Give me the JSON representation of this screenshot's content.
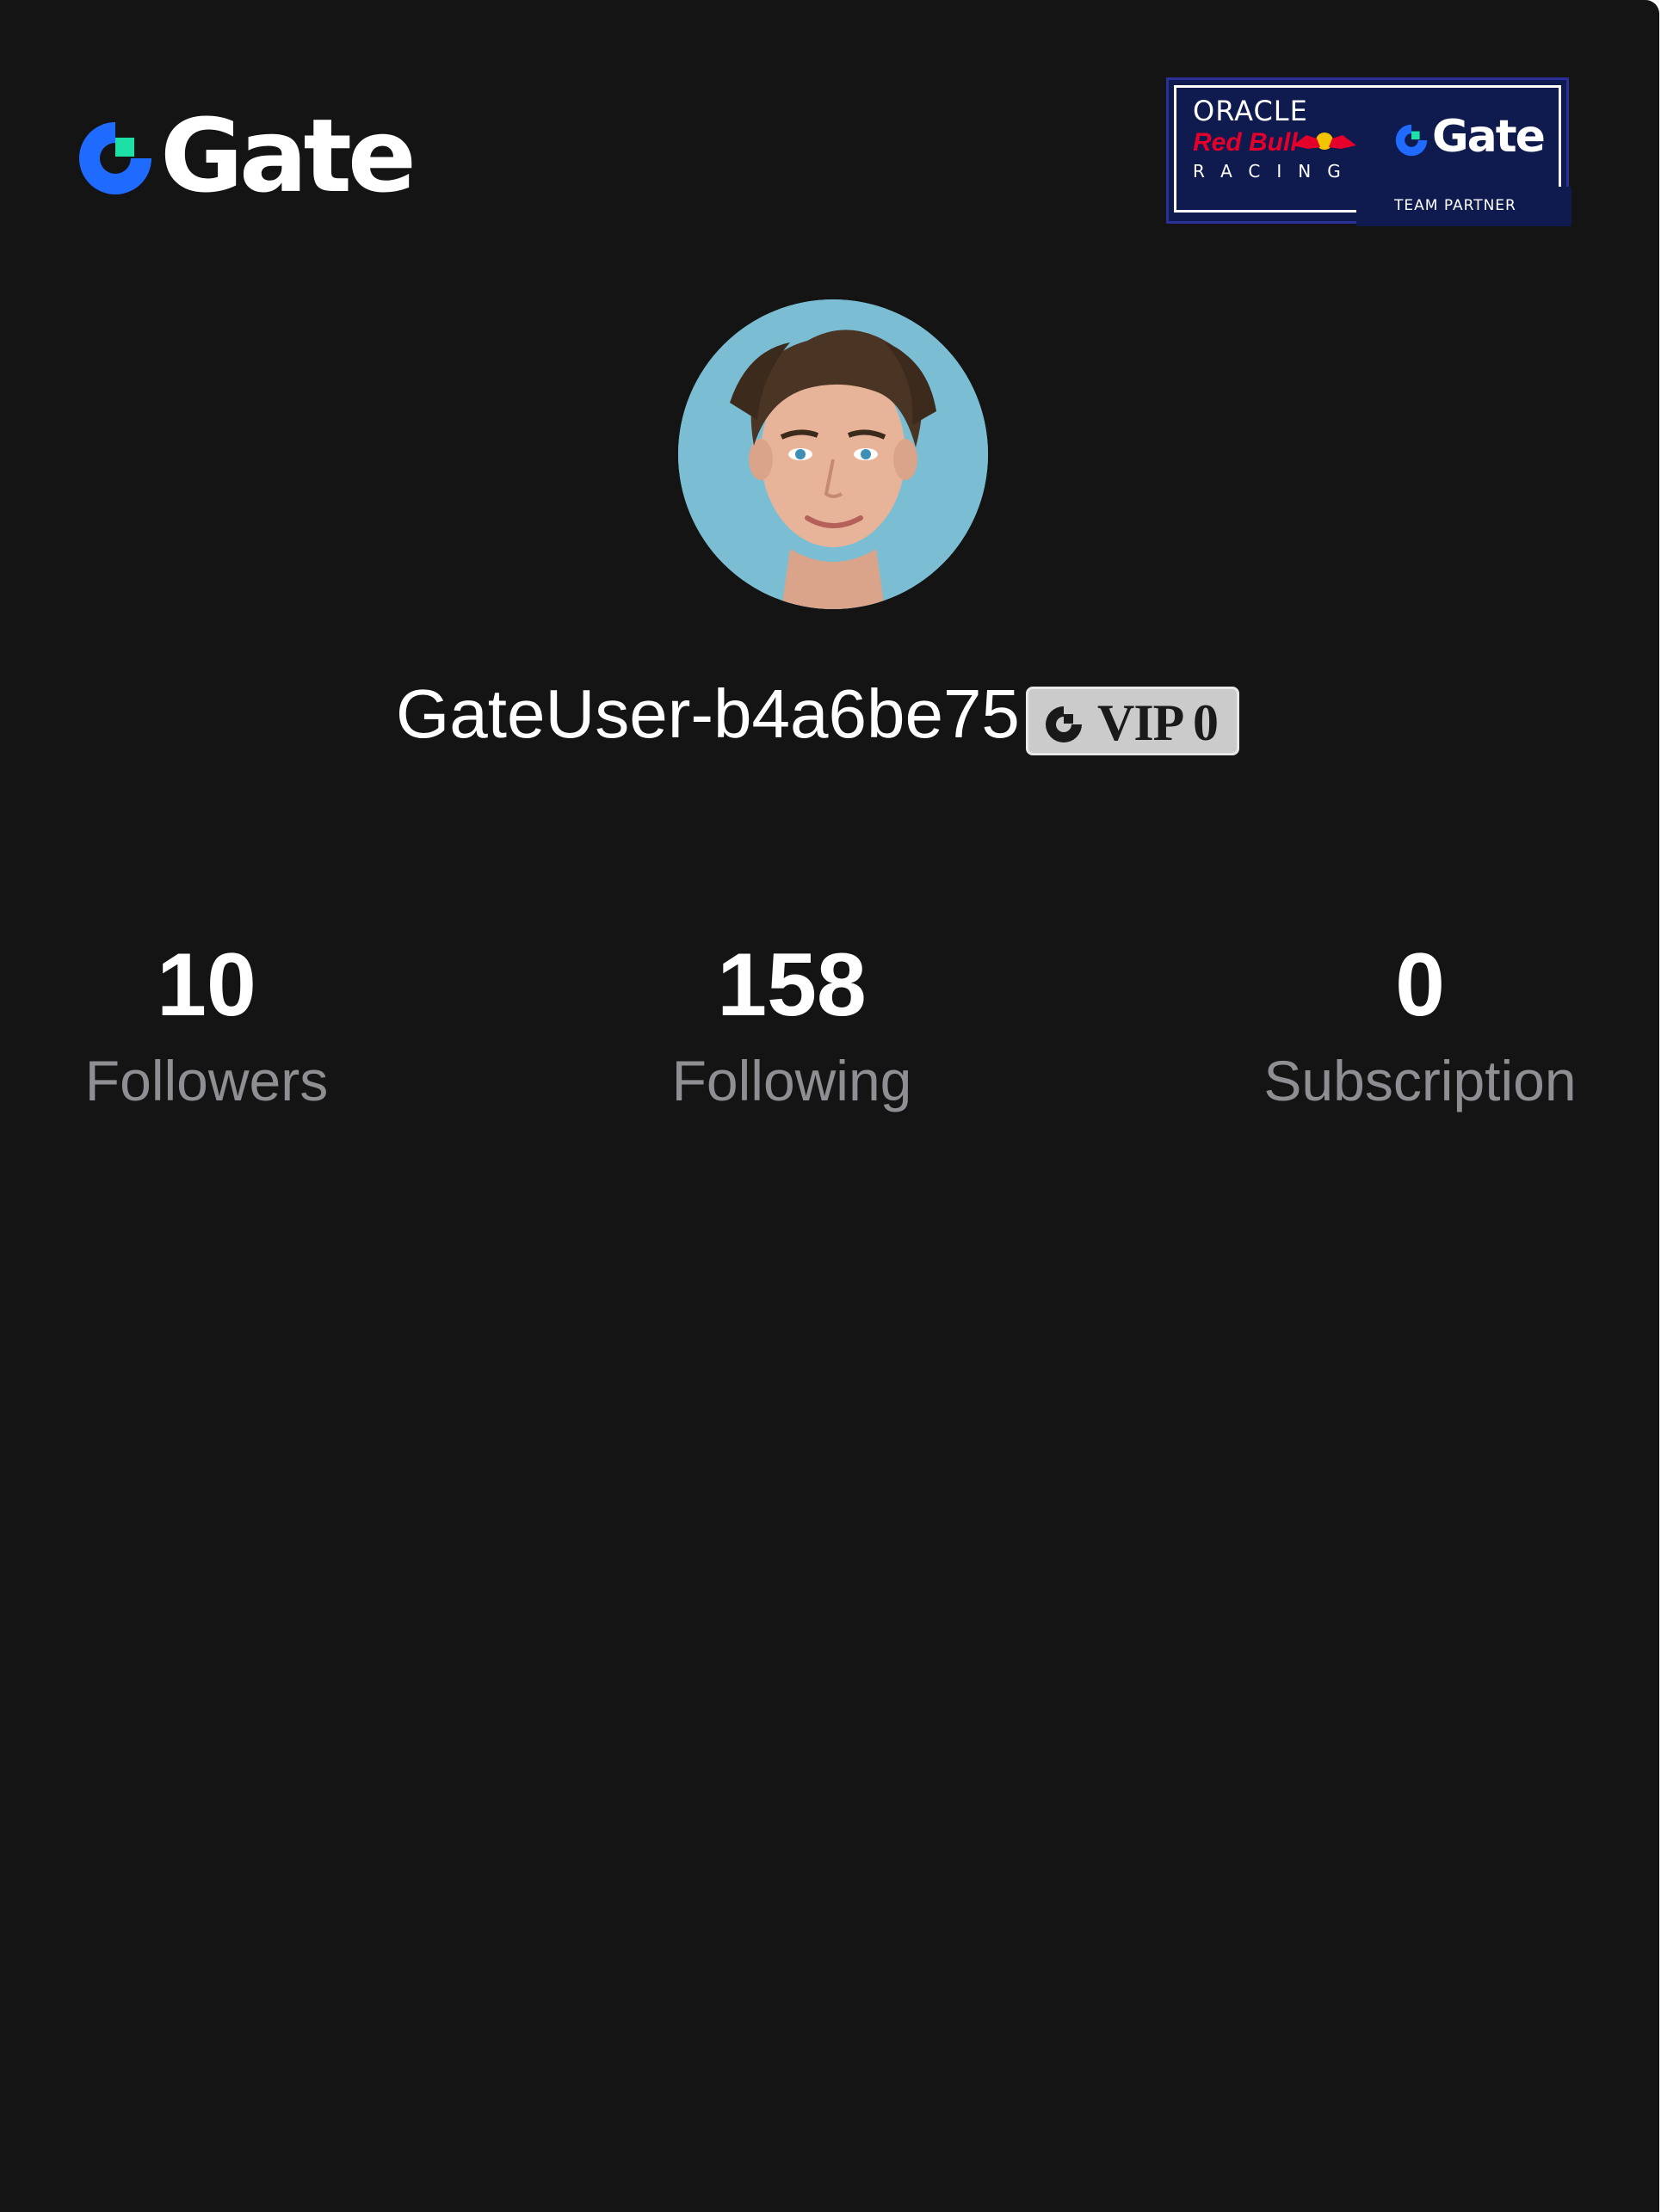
{
  "header": {
    "logo_text": "Gate",
    "partner_badge": {
      "line1": "ORACLE",
      "line2": "Red Bull",
      "line3": "RACING",
      "brand": "Gate",
      "caption": "TEAM PARTNER"
    }
  },
  "profile": {
    "avatar_alt": "avatar",
    "username": "GateUser-b4a6be75",
    "vip_label": "VIP 0"
  },
  "stats": [
    {
      "value": "10",
      "label": "Followers"
    },
    {
      "value": "158",
      "label": "Following"
    },
    {
      "value": "0",
      "label": "Subscription"
    }
  ],
  "colors": {
    "background": "#141415",
    "gate_blue": "#1f6bff",
    "gate_green": "#1de0a6",
    "muted_text": "#8f8f93",
    "partner_navy": "#0f1a4f"
  }
}
